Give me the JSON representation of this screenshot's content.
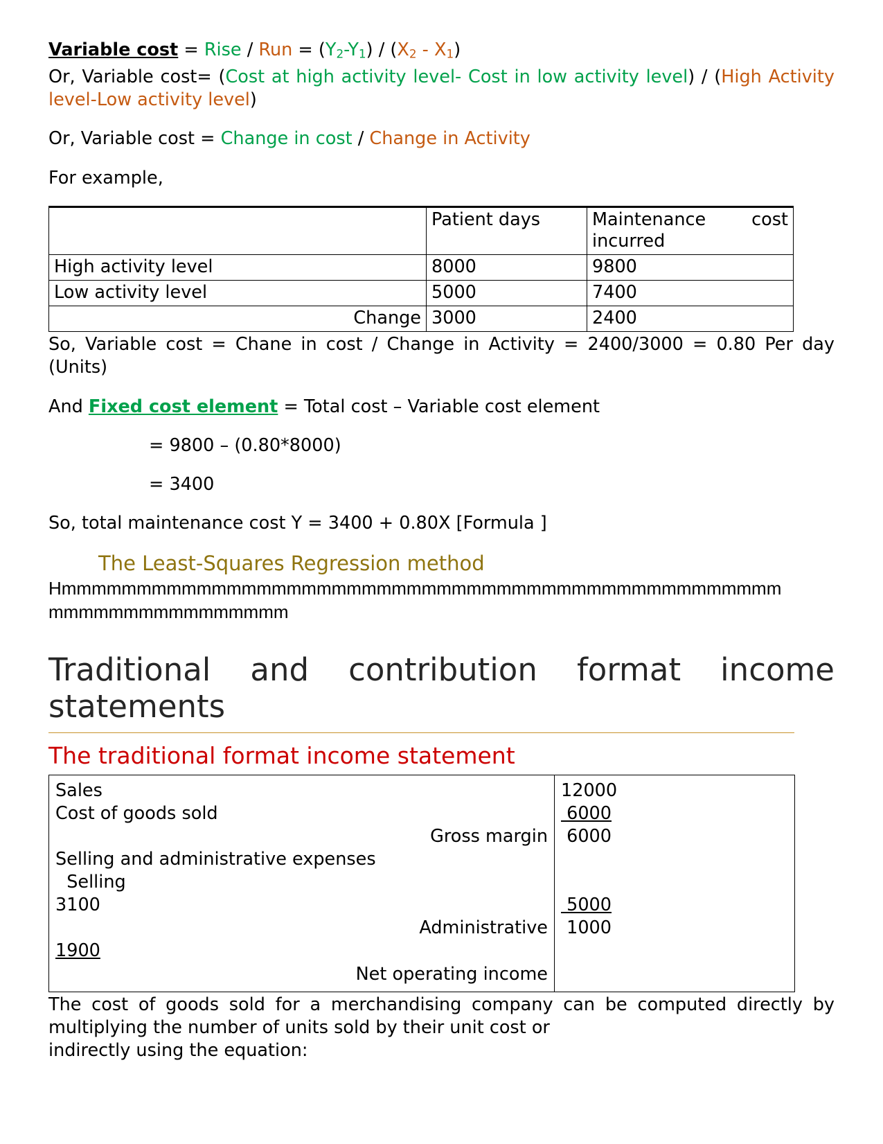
{
  "colors": {
    "green": "#00A14B",
    "orange": "#C55A11",
    "gold": "#8F7410",
    "red": "#CC0000",
    "rule": "#C8922C"
  },
  "formulas": {
    "line1": {
      "label": "Variable cost",
      "eq1": " = ",
      "rise": "Rise",
      "slash1": " / ",
      "run": "Run",
      "eq2": " = ",
      "open1": "(",
      "y2": "Y",
      "y2sub": "2",
      "dash": "-",
      "y1": "Y",
      "y1sub": "1",
      "close1": ")",
      "slash2": " / ",
      "open2": "(",
      "x2": "X",
      "x2sub": "2",
      "minus": " - ",
      "x1": "X",
      "x1sub": "1",
      "close2": ")"
    },
    "line2": {
      "prefix": "Or, Variable cost= ",
      "paren_open": "(",
      "green_text": "Cost at high activity level- Cost in low activity level",
      "paren_close": ") / ",
      "paren_open2": "(",
      "orange_text": "High Activity level-Low activity level",
      "paren_close2": ")"
    },
    "line3": {
      "prefix": "Or, Variable cost = ",
      "green_text": "Change in cost",
      "sep": " / ",
      "orange_text": "Change in Activity"
    },
    "for_example": "For example,"
  },
  "high_low_table": {
    "header": {
      "blank": "",
      "col2": "Patient days",
      "col3": "Maintenance cost incurred"
    },
    "rows": [
      {
        "label": "High activity level",
        "patient_days": "8000",
        "maintenance": "9800",
        "align": "left"
      },
      {
        "label": "Low activity level",
        "patient_days": "5000",
        "maintenance": "7400",
        "align": "left"
      },
      {
        "label": "Change",
        "patient_days": "3000",
        "maintenance": "2400",
        "align": "right"
      }
    ]
  },
  "after_table": {
    "line_a": "So, Variable cost = Chane in cost / Change in Activity = 2400/3000 = 0.80 Per day (Units)",
    "fixed_prefix": "And ",
    "fixed_label": "Fixed cost element",
    "fixed_rest": " = Total cost – Variable cost element",
    "calc1": "= 9800 – (0.80*8000)",
    "calc2": "= 3400",
    "total_formula": "So, total maintenance cost Y = 3400 + 0.80X [Formula ]"
  },
  "least_squares": {
    "heading": "The Least-Squares Regression method",
    "filler": "Hmmmmmmmmmmmmmmmmmmmmmmmmmmmmmmmmmmmmmmmmmmmmmmmmmmmmmmmmmmmmmmmm"
  },
  "section": {
    "title": "Traditional and contribution format income statements",
    "subtitle": "The traditional format income statement"
  },
  "income_statement": {
    "left_lines": [
      {
        "text": "Sales",
        "align": "left",
        "underline": false
      },
      {
        "text": "Cost of goods sold",
        "align": "left",
        "underline": false
      },
      {
        "text": "Gross margin",
        "align": "right",
        "underline": false
      },
      {
        "text": "Selling and administrative expenses",
        "align": "left",
        "underline": false
      },
      {
        "text": "  Selling",
        "align": "left",
        "underline": false
      },
      {
        "text": "3100",
        "align": "left",
        "underline": false
      },
      {
        "text": "Administrative",
        "align": "right",
        "underline": false
      },
      {
        "text": "1900",
        "align": "left",
        "underline": true
      },
      {
        "text": "Net operating income",
        "align": "right",
        "underline": false
      }
    ],
    "right_lines": [
      {
        "text": "12000",
        "underline": false
      },
      {
        "text": " 6000",
        "underline": true
      },
      {
        "text": " 6000",
        "underline": false
      },
      {
        "text": "",
        "underline": false
      },
      {
        "text": "",
        "underline": false
      },
      {
        "text": " 5000",
        "underline": true
      },
      {
        "text": " 1000",
        "underline": false
      },
      {
        "text": "",
        "underline": false
      },
      {
        "text": "",
        "underline": false
      }
    ]
  },
  "closing_paragraph": {
    "body": "The cost of goods sold for a merchandising company can be computed directly by multiplying the number of units sold by their unit cost or",
    "last_line": "indirectly using the equation:"
  }
}
